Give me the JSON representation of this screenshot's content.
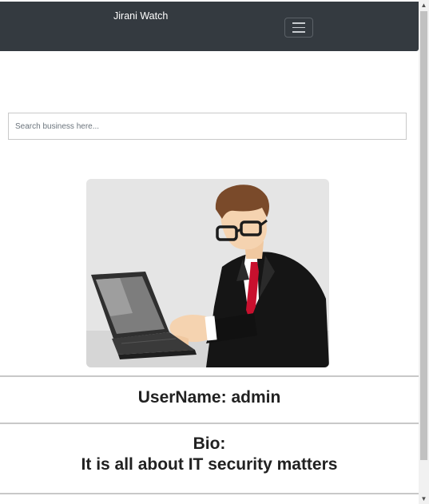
{
  "navbar": {
    "brand": "Jirani Watch",
    "toggler_icon": "hamburger-menu-icon"
  },
  "search": {
    "placeholder": "Search business here...",
    "value": ""
  },
  "profile": {
    "avatar_description": "man-at-laptop-illustration",
    "username": "UserName: admin",
    "bio_label": "Bio:",
    "bio_text": "It is all about IT security matters"
  },
  "colors": {
    "navbar_bg": "#343a40",
    "brand_text": "#ffffff",
    "heading_text": "#212121",
    "avatar_bg": "#e5e5e5",
    "tie": "#c8102e"
  }
}
